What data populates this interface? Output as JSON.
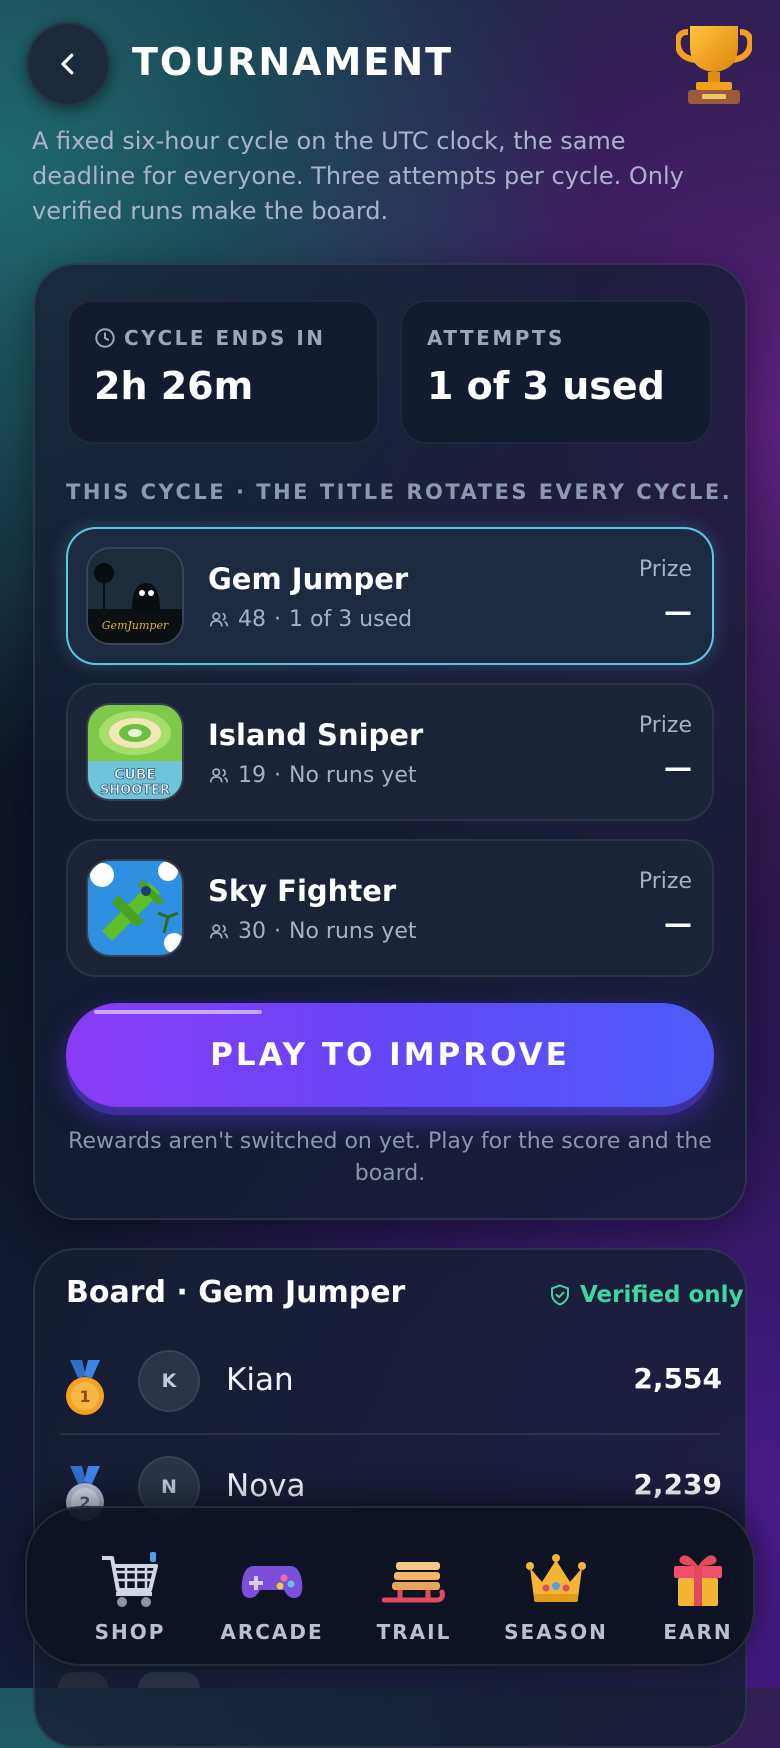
{
  "header": {
    "title": "TOURNAMENT",
    "back_icon": "chevron-left-icon",
    "trophy_icon": "trophy-icon",
    "intro": "A fixed six-hour cycle on the UTC clock, the same deadline for everyone. Three attempts per cycle. Only verified runs make the board."
  },
  "stats": {
    "cycle": {
      "label": "CYCLE ENDS IN",
      "value": "2h 26m",
      "icon": "clock-icon"
    },
    "attempts": {
      "label": "ATTEMPTS",
      "value": "1 of 3 used"
    }
  },
  "cycle_section": {
    "label": "THIS CYCLE · THE TITLE ROTATES EVERY CYCLE.",
    "games": [
      {
        "name": "Gem Jumper",
        "players": "48",
        "status": "1 of 3 used",
        "prize_label": "Prize",
        "prize_value": "—",
        "selected": true,
        "thumb_text": "GemJumper"
      },
      {
        "name": "Island Sniper",
        "players": "19",
        "status": "No runs yet",
        "prize_label": "Prize",
        "prize_value": "—",
        "selected": false,
        "thumb_text": [
          "CUBE",
          "SHOOTER"
        ]
      },
      {
        "name": "Sky Fighter",
        "players": "30",
        "status": "No runs yet",
        "prize_label": "Prize",
        "prize_value": "—",
        "selected": false
      }
    ],
    "separator": "·"
  },
  "play_button": {
    "label": "PLAY TO IMPROVE"
  },
  "rewards_note": "Rewards aren't switched on yet. Play for the score and the board.",
  "board": {
    "title": "Board · Gem Jumper",
    "verified_label": "Verified only",
    "rows": [
      {
        "rank": "1",
        "initial": "K",
        "name": "Kian",
        "score": "2,554"
      },
      {
        "rank": "2",
        "initial": "N",
        "name": "Nova",
        "score": "2,239"
      }
    ]
  },
  "nav": {
    "items": [
      {
        "label": "SHOP",
        "icon": "shopping-cart-icon"
      },
      {
        "label": "ARCADE",
        "icon": "gamepad-icon"
      },
      {
        "label": "TRAIL",
        "icon": "sled-icon"
      },
      {
        "label": "SEASON",
        "icon": "crown-icon"
      },
      {
        "label": "EARN",
        "icon": "gift-icon"
      }
    ]
  },
  "colors": {
    "accent_cyan": "#5fc6e6",
    "play_gradient_start": "#8a3cf5",
    "play_gradient_end": "#4d5cf8",
    "verified_green": "#3fd6a0"
  }
}
